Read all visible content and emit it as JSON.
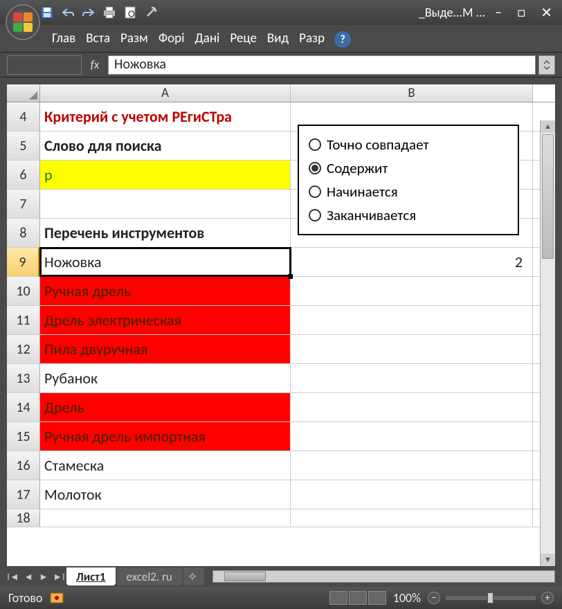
{
  "window": {
    "title": "_Выде...М ..."
  },
  "ribbon": {
    "tabs": [
      "Глав",
      "Вста",
      "Разм",
      "Форі",
      "Дані",
      "Реце",
      "Вид",
      "Разр"
    ]
  },
  "formula_bar": {
    "fx": "fx",
    "value": "Ножовка"
  },
  "columns": {
    "A": "A",
    "B": "B"
  },
  "rows": {
    "r4": {
      "num": "4",
      "A": "Критерий с учетом РЕгиСТра",
      "B": ""
    },
    "r5": {
      "num": "5",
      "A": "Слово для поиска",
      "B": ""
    },
    "r6": {
      "num": "6",
      "A": "р",
      "B": ""
    },
    "r7": {
      "num": "7",
      "A": "",
      "B": ""
    },
    "r8": {
      "num": "8",
      "A": "Перечень инструментов",
      "B": ""
    },
    "r9": {
      "num": "9",
      "A": "Ножовка",
      "B": "2"
    },
    "r10": {
      "num": "10",
      "A": "Ручная дрель",
      "B": ""
    },
    "r11": {
      "num": "11",
      "A": "Дрель электрическая",
      "B": ""
    },
    "r12": {
      "num": "12",
      "A": "Пила двуручная",
      "B": ""
    },
    "r13": {
      "num": "13",
      "A": "Рубанок",
      "B": ""
    },
    "r14": {
      "num": "14",
      "A": "Дрель",
      "B": ""
    },
    "r15": {
      "num": "15",
      "A": "Ручная дрель импортная",
      "B": ""
    },
    "r16": {
      "num": "16",
      "A": "Стамеска",
      "B": ""
    },
    "r17": {
      "num": "17",
      "A": "Молоток",
      "B": ""
    },
    "r18": {
      "num": "18",
      "A": "",
      "B": ""
    }
  },
  "options": {
    "opt1": "Точно совпадает",
    "opt2": "Содержит",
    "opt3": "Начинается",
    "opt4": "Заканчивается"
  },
  "sheet_tabs": {
    "sheet1": "Лист1",
    "sheet2": "excel2. ru"
  },
  "status": {
    "ready": "Готово",
    "zoom": "100%"
  }
}
